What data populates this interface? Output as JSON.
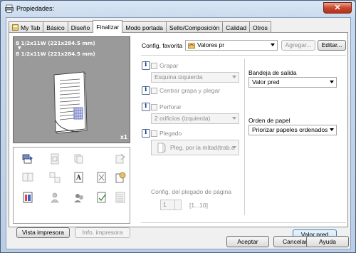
{
  "window": {
    "title": "Propiedades:",
    "close_glyph": "✕"
  },
  "tabs": [
    {
      "label": "My Tab",
      "icon": "my-tab-icon"
    },
    {
      "label": "Básico"
    },
    {
      "label": "Diseño"
    },
    {
      "label": "Finalizar",
      "active": true
    },
    {
      "label": "Modo portada"
    },
    {
      "label": "Sello/Composición"
    },
    {
      "label": "Calidad"
    },
    {
      "label": "Otros"
    }
  ],
  "preview": {
    "line1": "8 1/2x11W (221x284.5 mm)",
    "arrow": "▼",
    "line2": "8 1/2x11W (221x284.5 mm)",
    "copies": "x1"
  },
  "left_buttons": {
    "printer_view": "Vista impresora",
    "printer_info": "Info. impresora"
  },
  "favorites": {
    "label": "Config. favorita",
    "value": "Valores pr",
    "add": "Agregar...",
    "edit": "Editar..."
  },
  "staple": {
    "label": "Grapar",
    "value": "Esquina izquierda"
  },
  "center_staple": {
    "label": "Centrar grapa y plegar"
  },
  "punch": {
    "label": "Perforar",
    "value": "2 orificios (izquierda)"
  },
  "fold": {
    "label": "Plegado",
    "value": "Pleg. por la mitad(trab.c"
  },
  "fold_setting": {
    "label": "Config. del plegado de página",
    "value": "1",
    "range": "[1...10]"
  },
  "output_tray": {
    "label": "Bandeja de salida",
    "value": "Valor pred"
  },
  "paper_order": {
    "label": "Orden de papel",
    "value": "Priorizar papeles ordenados"
  },
  "panel_default": "Valor pred",
  "dialog_buttons": {
    "ok": "Aceptar",
    "cancel": "Cancelar",
    "help": "Ayuda"
  },
  "colors": {
    "titlebar": "#c7d8ec",
    "preview_bg": "#9a9a9a",
    "close": "#c9462c"
  }
}
